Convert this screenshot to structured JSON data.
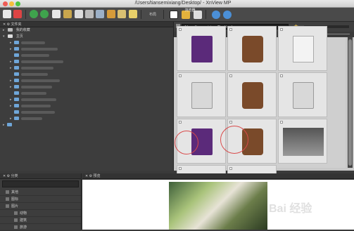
{
  "window": {
    "title": "/Users/tiansemixiang/Desktop/ - XnView MP"
  },
  "tabs": {
    "browser": "浏览器"
  },
  "toolbar": {
    "layout_label": "布局"
  },
  "left_panel": {
    "header": "文件夹",
    "tree": [
      {
        "label": "我的收藏"
      },
      {
        "label": "主页"
      }
    ]
  },
  "path": {
    "value": "/Users/tiansemixiang/Desktop/"
  },
  "thumbnails": [
    {
      "kind": "video-file"
    },
    {
      "kind": "archive-file"
    },
    {
      "kind": "text-file"
    },
    {
      "kind": "disk-image"
    },
    {
      "kind": "archive-file"
    },
    {
      "kind": "disk-image"
    },
    {
      "kind": "video-file"
    },
    {
      "kind": "archive-file"
    },
    {
      "kind": "screenshot"
    },
    {
      "kind": "photo"
    },
    {
      "kind": "screenshot"
    }
  ],
  "categories_panel": {
    "header": "分类",
    "items": [
      {
        "label": "其他"
      },
      {
        "label": "图标"
      },
      {
        "label": "图片"
      },
      {
        "label": "动物"
      },
      {
        "label": "建筑"
      },
      {
        "label": "旅游"
      }
    ]
  },
  "preview_panel": {
    "header": "预览",
    "watermark": "Bai 经验"
  },
  "colors": {
    "accent": "#f5c542",
    "highlight_circle": "#d94a4a",
    "folder": "#6fa6d8"
  }
}
